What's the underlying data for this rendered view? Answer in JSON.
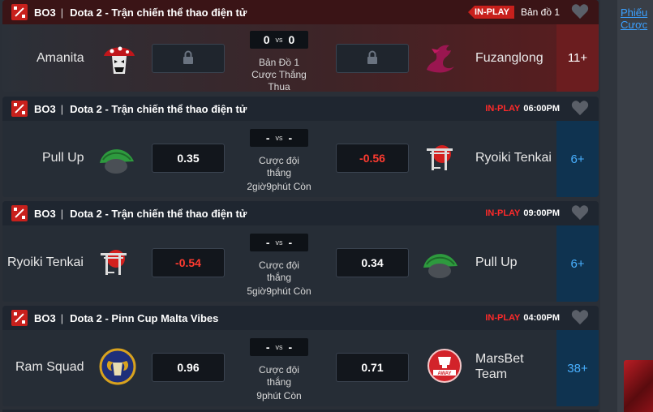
{
  "bet_slip": {
    "line1": "Phiếu",
    "line2": "Cược"
  },
  "matches": [
    {
      "bo": "BO3",
      "separator": "|",
      "title": "Dota 2 - Trận chiến thể thao điện tử",
      "status": "IN-PLAY",
      "map": "Bản đồ 1",
      "team1": "Amanita",
      "team2": "Fuzanglong",
      "score1": "0",
      "score2": "0",
      "vs": "vs",
      "line1": "Bản Đồ 1",
      "line2": "Cược Thắng",
      "line3": "Thua",
      "more": "11+"
    },
    {
      "bo": "BO3",
      "separator": "|",
      "title": "Dota 2 - Trận chiến thể thao điện tử",
      "status": "IN-PLAY",
      "time": "06:00PM",
      "team1": "Pull Up",
      "team2": "Ryoiki Tenkai",
      "odd1": "0.35",
      "odd2": "-0.56",
      "score1": "-",
      "score2": "-",
      "vs": "vs",
      "line1": "Cược đội",
      "line2": "thắng",
      "line3": "2giờ9phút Còn",
      "more": "6+"
    },
    {
      "bo": "BO3",
      "separator": "|",
      "title": "Dota 2 - Trận chiến thể thao điện tử",
      "status": "IN-PLAY",
      "time": "09:00PM",
      "team1": "Ryoiki Tenkai",
      "team2": "Pull Up",
      "odd1": "-0.54",
      "odd2": "0.34",
      "score1": "-",
      "score2": "-",
      "vs": "vs",
      "line1": "Cược đội",
      "line2": "thắng",
      "line3": "5giờ9phút Còn",
      "more": "6+"
    },
    {
      "bo": "BO3",
      "separator": "|",
      "title": "Dota 2 - Pinn Cup Malta Vibes",
      "status": "IN-PLAY",
      "time": "04:00PM",
      "team1": "Ram Squad",
      "team2_line1": "MarsBet",
      "team2_line2": "Team",
      "odd1": "0.96",
      "odd2": "0.71",
      "score1": "-",
      "score2": "-",
      "vs": "vs",
      "line1": "Cược đội",
      "line2": "thắng",
      "line3": "9phút Còn",
      "more": "38+"
    }
  ],
  "colors": {
    "in_play": "#ff2a2a",
    "negative_odd": "#ff3b30",
    "more_bets": "#49b0ff"
  }
}
